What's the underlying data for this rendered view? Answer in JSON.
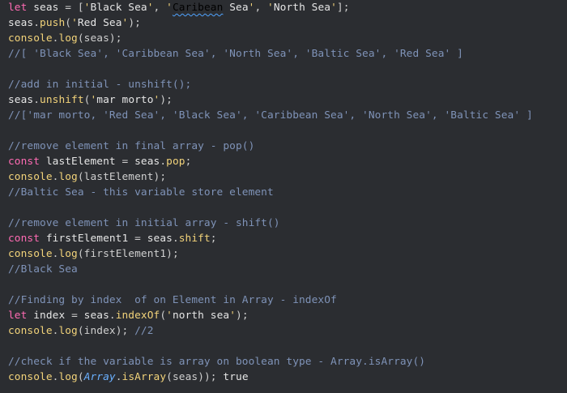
{
  "lines": [
    {
      "t": [
        [
          "kw",
          "let"
        ],
        [
          "v",
          " seas "
        ],
        [
          "p",
          "= ["
        ],
        [
          "q",
          "'"
        ],
        [
          "str",
          "Black Sea"
        ],
        [
          "q",
          "'"
        ],
        [
          "p",
          ", "
        ],
        [
          "q",
          "'"
        ],
        [
          "squig",
          "Caribean"
        ],
        [
          "str",
          " Sea"
        ],
        [
          "q",
          "'"
        ],
        [
          "p",
          ", "
        ],
        [
          "q",
          "'"
        ],
        [
          "str",
          "North Sea"
        ],
        [
          "q",
          "'"
        ],
        [
          "p",
          "];"
        ]
      ]
    },
    {
      "t": [
        [
          "v",
          "seas"
        ],
        [
          "p",
          "."
        ],
        [
          "fn",
          "push"
        ],
        [
          "p",
          "("
        ],
        [
          "q",
          "'"
        ],
        [
          "str",
          "Red Sea"
        ],
        [
          "q",
          "'"
        ],
        [
          "p",
          ");"
        ]
      ]
    },
    {
      "t": [
        [
          "fn",
          "console"
        ],
        [
          "p",
          "."
        ],
        [
          "fn",
          "log"
        ],
        [
          "p",
          "(seas);"
        ]
      ]
    },
    {
      "t": [
        [
          "cm",
          "//[ 'Black Sea', 'Caribbean Sea', 'North Sea', 'Baltic Sea', 'Red Sea' ]"
        ]
      ]
    },
    {
      "t": []
    },
    {
      "t": [
        [
          "cm",
          "//add in initial - unshift();"
        ]
      ]
    },
    {
      "t": [
        [
          "v",
          "seas"
        ],
        [
          "p",
          "."
        ],
        [
          "fn",
          "unshift"
        ],
        [
          "p",
          "("
        ],
        [
          "q",
          "'"
        ],
        [
          "str",
          "mar morto"
        ],
        [
          "q",
          "'"
        ],
        [
          "p",
          ");"
        ]
      ]
    },
    {
      "t": [
        [
          "cm",
          "//['mar morto, 'Red Sea', 'Black Sea', 'Caribbean Sea', 'North Sea', 'Baltic Sea' ]"
        ]
      ]
    },
    {
      "t": []
    },
    {
      "t": [
        [
          "cm",
          "//remove element in final array - pop()"
        ]
      ]
    },
    {
      "t": [
        [
          "kw",
          "const"
        ],
        [
          "v",
          " lastElement "
        ],
        [
          "p",
          "= "
        ],
        [
          "v",
          "seas"
        ],
        [
          "p",
          "."
        ],
        [
          "fn",
          "pop"
        ],
        [
          "p",
          ";"
        ]
      ]
    },
    {
      "t": [
        [
          "fn",
          "console"
        ],
        [
          "p",
          "."
        ],
        [
          "fn",
          "log"
        ],
        [
          "p",
          "(lastElement);"
        ]
      ]
    },
    {
      "t": [
        [
          "cm",
          "//Baltic Sea - this variable store element"
        ]
      ]
    },
    {
      "t": []
    },
    {
      "t": [
        [
          "cm",
          "//remove element in initial array - shift()"
        ]
      ]
    },
    {
      "t": [
        [
          "kw",
          "const"
        ],
        [
          "v",
          " firstElement1 "
        ],
        [
          "p",
          "= "
        ],
        [
          "v",
          "seas"
        ],
        [
          "p",
          "."
        ],
        [
          "fn",
          "shift"
        ],
        [
          "p",
          ";"
        ]
      ]
    },
    {
      "t": [
        [
          "fn",
          "console"
        ],
        [
          "p",
          "."
        ],
        [
          "fn",
          "log"
        ],
        [
          "p",
          "(firstElement1);"
        ]
      ]
    },
    {
      "t": [
        [
          "cm",
          "//Black Sea"
        ]
      ]
    },
    {
      "t": []
    },
    {
      "t": [
        [
          "cm",
          "//Finding by index  of on Element in Array - indexOf"
        ]
      ]
    },
    {
      "t": [
        [
          "kw",
          "let"
        ],
        [
          "v",
          " index "
        ],
        [
          "p",
          "= "
        ],
        [
          "v",
          "seas"
        ],
        [
          "p",
          "."
        ],
        [
          "fn",
          "indexOf"
        ],
        [
          "p",
          "("
        ],
        [
          "q",
          "'"
        ],
        [
          "str",
          "north sea"
        ],
        [
          "q",
          "'"
        ],
        [
          "p",
          ");"
        ]
      ]
    },
    {
      "t": [
        [
          "fn",
          "console"
        ],
        [
          "p",
          "."
        ],
        [
          "fn",
          "log"
        ],
        [
          "p",
          "(index); "
        ],
        [
          "cm",
          "//2"
        ]
      ]
    },
    {
      "t": []
    },
    {
      "t": [
        [
          "cm",
          "//check if the variable is array on boolean type - Array.isArray()"
        ]
      ]
    },
    {
      "t": [
        [
          "fn",
          "console"
        ],
        [
          "p",
          "."
        ],
        [
          "fn",
          "log"
        ],
        [
          "p",
          "("
        ],
        [
          "cls",
          "Array"
        ],
        [
          "p",
          "."
        ],
        [
          "fn",
          "isArray"
        ],
        [
          "p",
          "(seas)); "
        ],
        [
          "bool",
          "true"
        ]
      ]
    }
  ]
}
